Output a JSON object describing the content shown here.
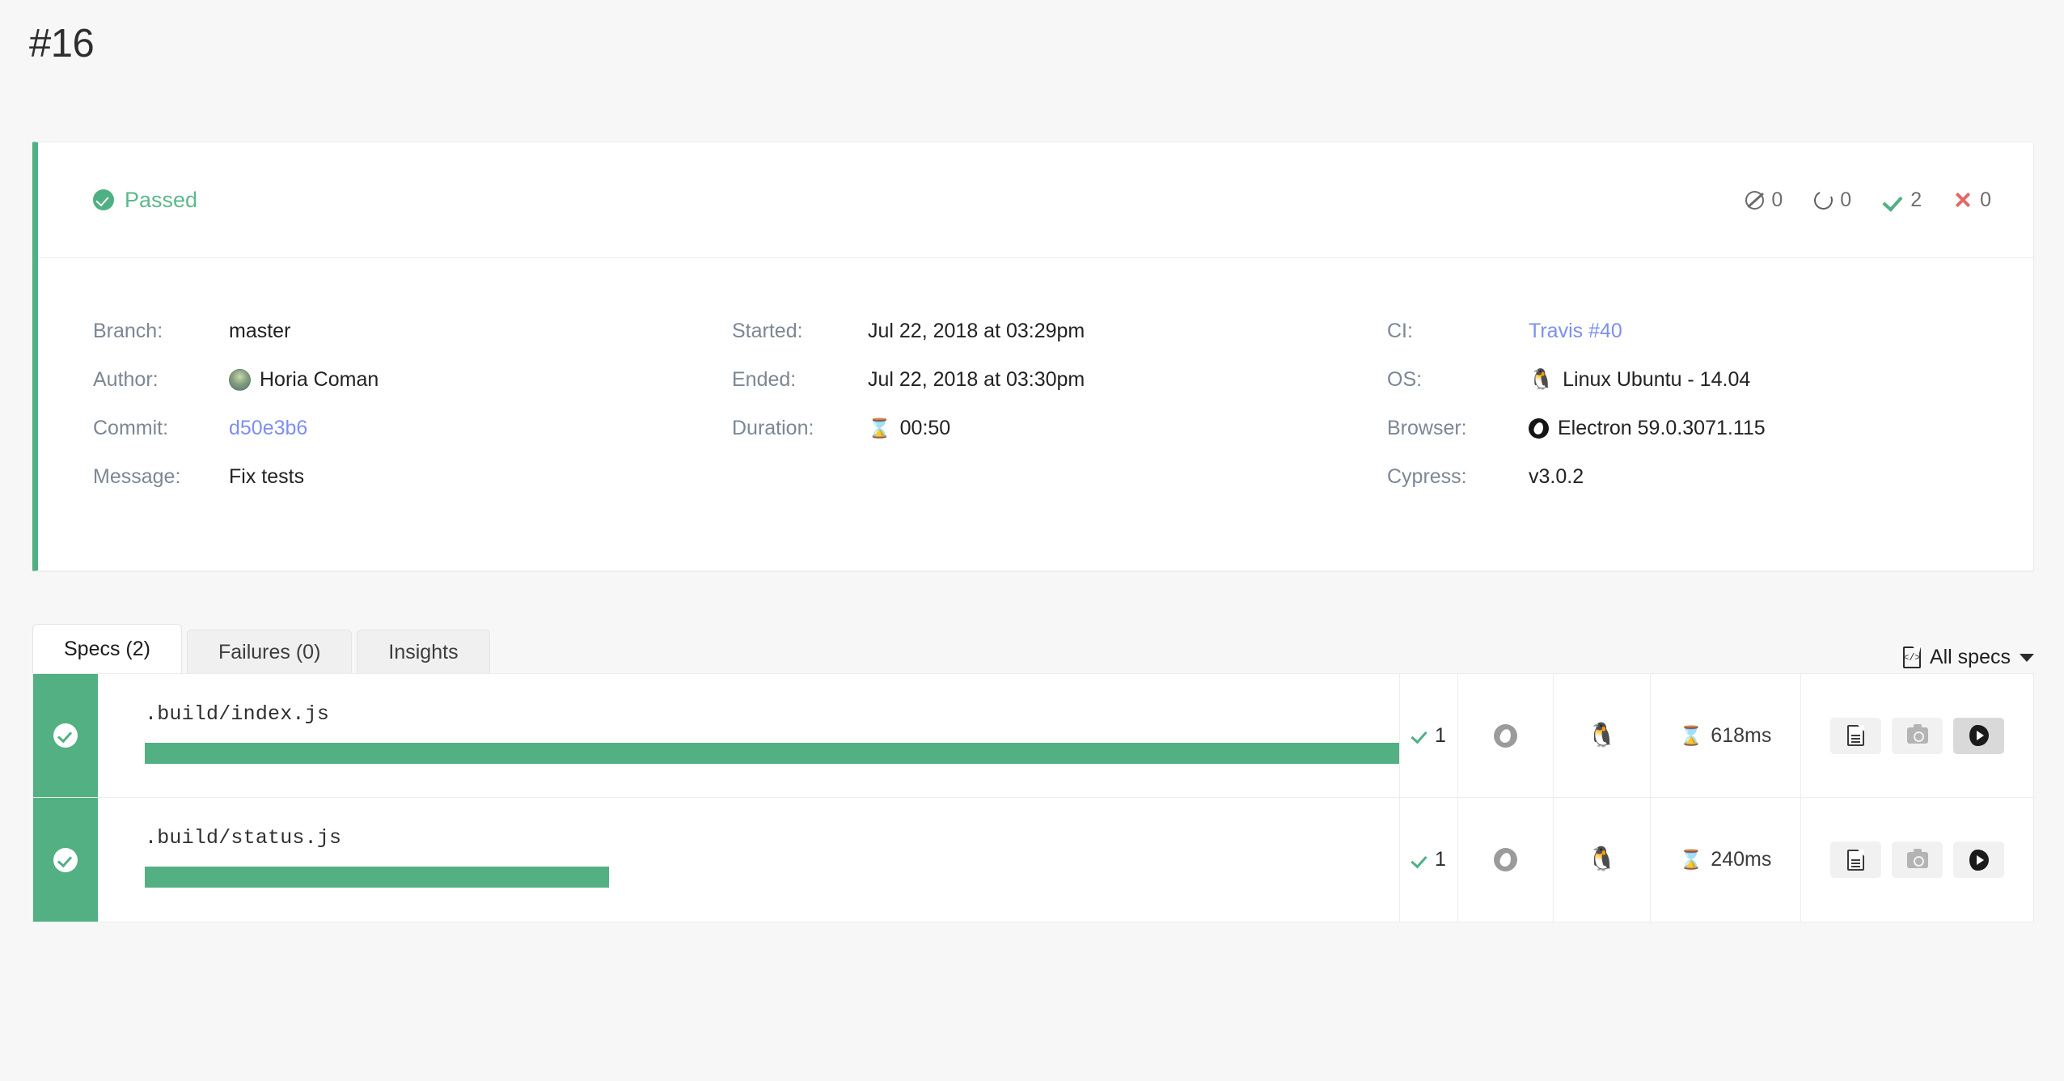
{
  "build": {
    "title": "#16"
  },
  "summary": {
    "status_label": "Passed",
    "counters": [
      {
        "icon": "skipped-icon",
        "value": "0"
      },
      {
        "icon": "pending-icon",
        "value": "0"
      },
      {
        "icon": "passed-check-icon",
        "value": "2"
      },
      {
        "icon": "failed-x-icon",
        "value": "0"
      }
    ],
    "columns": [
      {
        "rows": [
          {
            "key": "Branch:",
            "value": "master"
          },
          {
            "key": "Author:",
            "value": "Horia Coman"
          },
          {
            "key": "Commit:",
            "value": "d50e3b6"
          },
          {
            "key": "Message:",
            "value": "Fix tests"
          }
        ]
      },
      {
        "rows": [
          {
            "key": "Started:",
            "value": "Jul 22, 2018 at 03:29pm"
          },
          {
            "key": "Ended:",
            "value": "Jul 22, 2018 at 03:30pm"
          },
          {
            "key": "Duration:",
            "value": "00:50"
          }
        ]
      },
      {
        "rows": [
          {
            "key": "CI:",
            "value": "Travis #40"
          },
          {
            "key": "OS:",
            "value": "Linux Ubuntu - 14.04"
          },
          {
            "key": "Browser:",
            "value": "Electron 59.0.3071.115"
          },
          {
            "key": "Cypress:",
            "value": "v3.0.2"
          }
        ]
      }
    ]
  },
  "tabs": [
    {
      "label": "Specs (2)",
      "active": true
    },
    {
      "label": "Failures (0)",
      "active": false
    },
    {
      "label": "Insights",
      "active": false
    }
  ],
  "filter": {
    "label": "All specs"
  },
  "specs": [
    {
      "status": "passed",
      "name": ".build/index.js",
      "passed_count": "1",
      "duration": "618ms",
      "bar_width_pct": 100,
      "browser_icon": "chrome-icon",
      "os_icon": "linux-penguin-icon",
      "actions": [
        {
          "icon": "log-document-icon",
          "active": false
        },
        {
          "icon": "screenshot-camera-icon",
          "active": false
        },
        {
          "icon": "video-play-icon",
          "active": true
        }
      ]
    },
    {
      "status": "passed",
      "name": ".build/status.js",
      "passed_count": "1",
      "duration": "240ms",
      "bar_width_pct": 37,
      "browser_icon": "chrome-icon",
      "os_icon": "linux-penguin-icon",
      "actions": [
        {
          "icon": "log-document-icon",
          "active": false
        },
        {
          "icon": "screenshot-camera-icon",
          "active": false
        },
        {
          "icon": "video-play-icon",
          "active": false
        }
      ]
    }
  ],
  "colors": {
    "pass_green": "#52b083",
    "status_text_green": "#5cb98c",
    "link_blue": "#7d8ff0",
    "fail_red": "#e26a6a",
    "page_bg": "#f7f7f7"
  },
  "glyphs": {
    "hourglass": "⌛",
    "penguin": "🐧"
  }
}
